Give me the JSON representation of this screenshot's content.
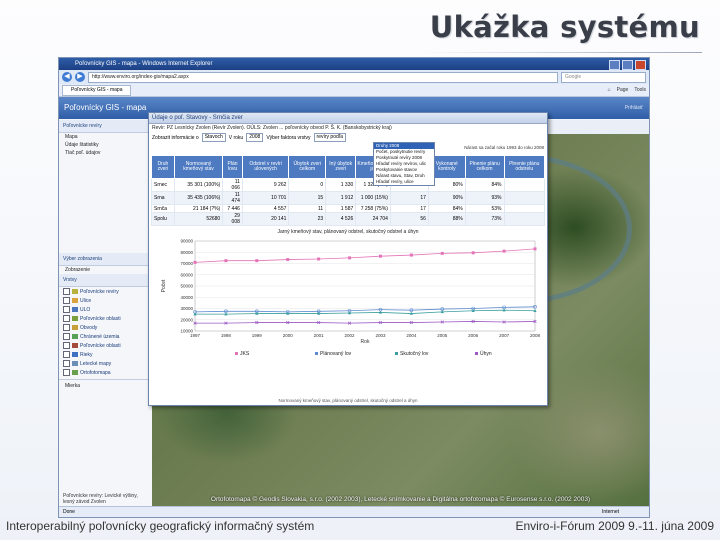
{
  "slide": {
    "title": "Ukážka systému",
    "footer_left": "Interoperabilný poľovnícky geografický informačný systém",
    "footer_right": "Enviro-i-Fórum 2009 9.-11. júna 2009"
  },
  "browser": {
    "window_title": "Poľovnícky GIS - mapa - Windows Internet Explorer",
    "address": "http://www.enviro.org/index-gis/mapa2.aspx",
    "search_placeholder": "Google",
    "tab_label": "Poľovnícky GIS - mapa",
    "commands": [
      "Page",
      "Tools"
    ],
    "status_left": "Done",
    "status_right": "Internet"
  },
  "app": {
    "title": "Poľovnícky GIS - mapa",
    "header_right": "Prihlásiť",
    "left_panel": {
      "section1_title": "Poľovnícke revíry",
      "section1_items": [
        "Mapa",
        "Údaje štatistiky",
        "Tlač poľ. údajov"
      ],
      "section2_title": "Výber zobrazenia",
      "section3_title": "Zobrazenie",
      "layers_title": "Vrstvy",
      "layers": [
        {
          "label": "Poľovnícke revíry",
          "color": "#b7b23d"
        },
        {
          "label": "Ulice",
          "color": "#d9a23c"
        },
        {
          "label": "ULO",
          "color": "#4c77bd"
        },
        {
          "label": "Poľovnícke oblasti",
          "color": "#7b9f3b"
        },
        {
          "label": "Obvody",
          "color": "#c8a03a"
        },
        {
          "label": "Chránené územia",
          "color": "#55a155"
        },
        {
          "label": "Poľovnícke oblasti",
          "color": "#a34c3c"
        },
        {
          "label": "Rieky",
          "color": "#3e70c2"
        },
        {
          "label": "Letecké mapy",
          "color": "#6a8eb6"
        },
        {
          "label": "Ortofotomapa",
          "color": "#6aa04c"
        }
      ],
      "footer_label": "Mierka",
      "footer_text": "Poľovnícke revíry: Levické výšiny, lesný závod Zvolen"
    }
  },
  "dialog": {
    "title": "Údaje o poľ. Stavovy - Srnčia zver",
    "info_line": "Revír: PZ Lesnícky Zvolen (Revír Zvolen). OÚLS: Zvolen ... poľovnícky obvod P. Š. K. (Banskobystrický kraj)",
    "filter_label1": "Zobrazit informácie o",
    "filter_value1": "Stavoch",
    "filter_label2": "V roku",
    "filter_value2": "2008",
    "filter_label3": "Výber faktora vrstvy",
    "filter_value3": "revíry podľa",
    "dropdown_options": [
      "Druhy 2008",
      "Počet, poskytnutie revíry",
      "Poskytnuté revíry 2008",
      "Hľadať revíry revírov, ulic",
      "Poskytovanie stavov",
      "Nárast stavu, Stav, Druh",
      "Hľadať revíry, ulice"
    ],
    "right_note": "Nárast sa začal roku 1993 do roku 2008",
    "columns": [
      "Druh zveri",
      "Normovaný kmeňový stav",
      "Plán lovu",
      "Odstrel v revíri ulovených",
      "Úbytok zveri celkom",
      "Iný úbytok zveri",
      "Kmeňový stav jar",
      "Jarný kmeňový stav",
      "Vykonané kontroly",
      "Plnenie plánu celkom",
      "Plnenie plánu odstrelu"
    ],
    "rows": [
      [
        "Srnec",
        "35 301 (100%)",
        "11 066",
        "9 262",
        "0",
        "1 330",
        "1 320 (?%)",
        "33",
        "80%",
        "84%"
      ],
      [
        "Srna",
        "35 435 (106%)",
        "11 474",
        "10 701",
        "15",
        "1 912",
        "1 000 (15%)",
        "17",
        "90%",
        "93%"
      ],
      [
        "Srnča",
        "21 184 (?%)",
        "7 446",
        "4 557",
        "11",
        "1 587",
        "7 258 (75%)",
        "17",
        "84%",
        "53%"
      ],
      [
        "Spolu",
        "52680",
        "29 008",
        "20 141",
        "23",
        "4 526",
        "24 704",
        "56",
        "88%",
        "73%"
      ]
    ],
    "footer_text": "Normovaný kmeňový stav, plánovaný odstrel, skutočný odstrel a úhyn"
  },
  "chart_data": {
    "type": "line",
    "title": "Jarný kmeňový stav, plánovaný odstrel, skutočný odstrel a úhyn",
    "xlabel": "Rok",
    "ylabel": "Počet",
    "x": [
      "1997",
      "1998",
      "1999",
      "2000",
      "2001",
      "2002",
      "2003",
      "2004",
      "2005",
      "2006",
      "2007",
      "2008"
    ],
    "ylim": [
      10000,
      90000
    ],
    "y_ticks": [
      "90000",
      "80000",
      "70000",
      "60000",
      "50000",
      "40000",
      "30000",
      "20000",
      "10000"
    ],
    "series": [
      {
        "name": "JKS",
        "color": "#e374b8",
        "values": [
          71000,
          72500,
          72500,
          73500,
          74000,
          75000,
          76500,
          77500,
          79000,
          79500,
          81000,
          83000
        ]
      },
      {
        "name": "Plánovaný lov",
        "color": "#5c8bcf",
        "values": [
          27000,
          27500,
          27500,
          27000,
          27500,
          28000,
          29000,
          28500,
          29500,
          30000,
          31000,
          31500
        ]
      },
      {
        "name": "Skutočný lov",
        "color": "#3a9e9e",
        "values": [
          25000,
          25000,
          25500,
          25500,
          25500,
          26000,
          26500,
          25500,
          27000,
          28000,
          28500,
          28000
        ]
      },
      {
        "name": "Úhyn",
        "color": "#9b59c4",
        "values": [
          17000,
          17000,
          17500,
          17500,
          17500,
          17000,
          17500,
          17500,
          18000,
          18500,
          18000,
          18500
        ]
      }
    ]
  },
  "map": {
    "copyright": "Ortofotomapa © Geodis Slovakia, s.r.o. (2002 2003), Letecké snímkovanie a Digitálna ortofotomapa © Eurosense s.r.o. (2002 2003)"
  }
}
